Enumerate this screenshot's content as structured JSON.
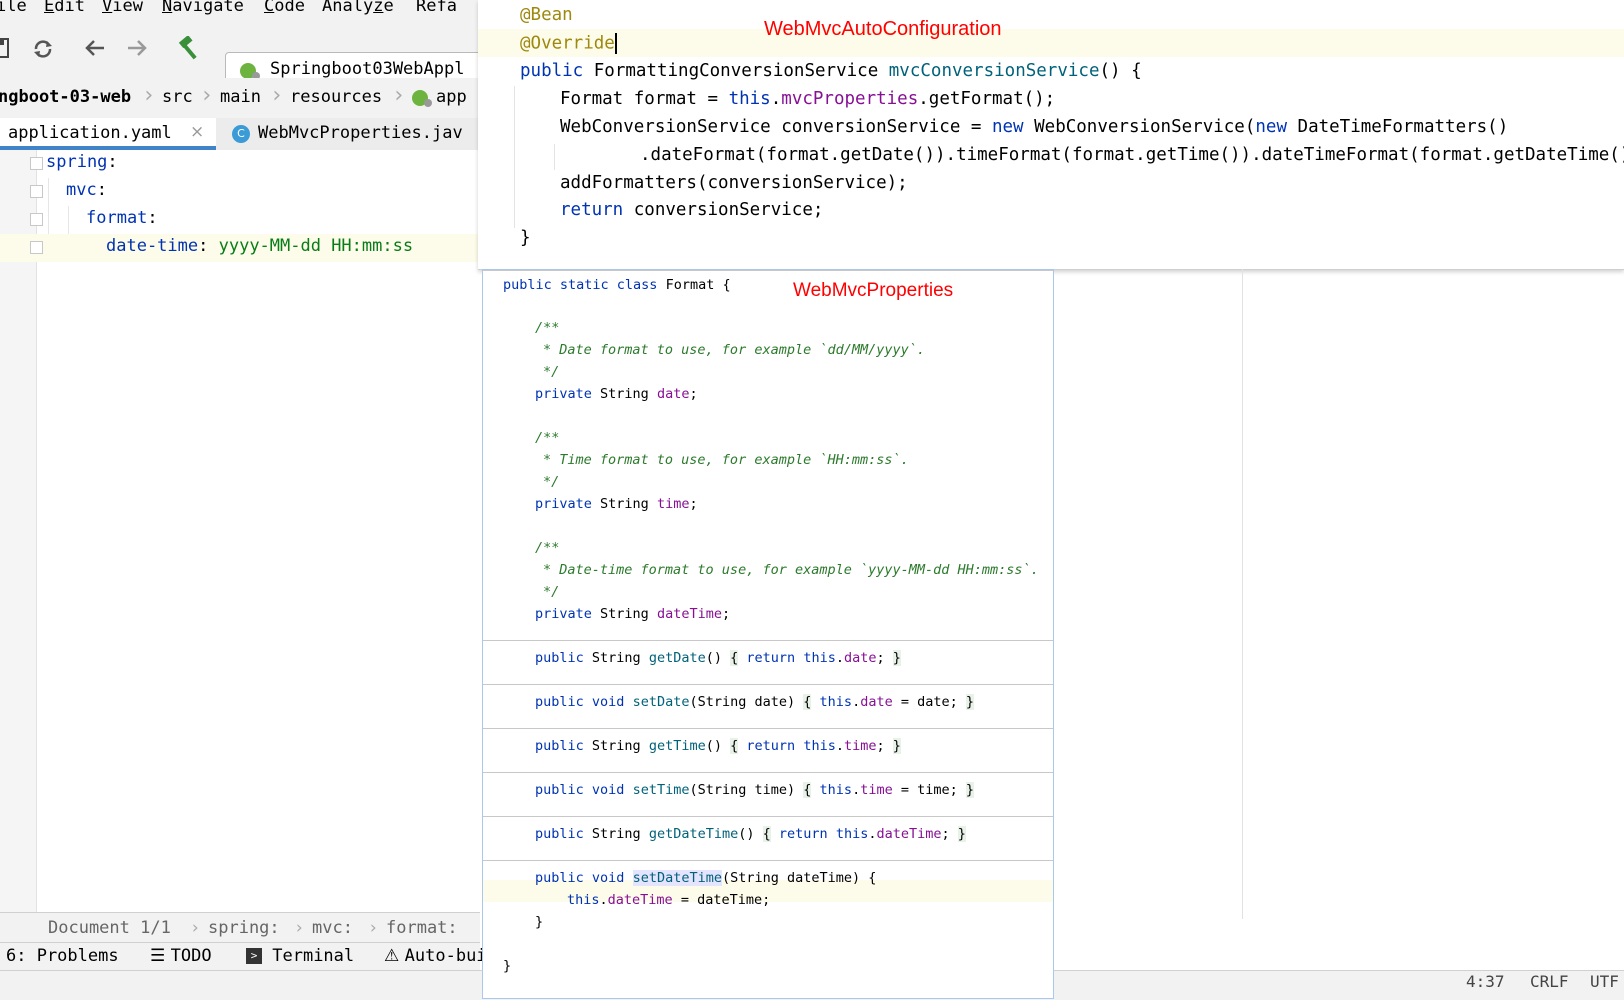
{
  "menu": [
    "ile",
    "Edit",
    "View",
    "Navigate",
    "Code",
    "Analyze",
    "Refa"
  ],
  "toolbar": {
    "run_config": "Springboot03WebAppl",
    "icons": [
      "save-icon",
      "sync-icon",
      "back-arrow-icon",
      "forward-arrow-icon",
      "build-hammer-icon",
      "spring-boot-icon"
    ]
  },
  "breadcrumb": [
    "ngboot-03-web",
    "src",
    "main",
    "resources",
    "app"
  ],
  "tabs": {
    "active": "application.yaml",
    "second": "WebMvcProperties.jav",
    "second_icon_letter": "C"
  },
  "yaml": {
    "lines": [
      {
        "key": "spring",
        "colon": ":",
        "value": ""
      },
      {
        "key": "mvc",
        "colon": ":",
        "value": ""
      },
      {
        "key": "format",
        "colon": ":",
        "value": ""
      },
      {
        "key": "date-time",
        "colon": ": ",
        "value": "yyyy-MM-dd HH:mm:ss"
      }
    ]
  },
  "status_breadcrumb": [
    "Document 1/1",
    "spring:",
    "mvc:",
    "format:"
  ],
  "toolwindows": [
    "6: Problems",
    "TODO",
    "Terminal",
    "Auto-bui"
  ],
  "statusbar": {
    "position": "4:37",
    "line_sep": "CRLF",
    "encoding": "UTF"
  },
  "auto_config": {
    "label": "WebMvcAutoConfiguration",
    "lines": {
      "l1": "@Bean",
      "l2": "@Override",
      "l3_kw": "public",
      "l3_type": " FormattingConversionService ",
      "l3_m": "mvcConversionService",
      "l3_end": "() {",
      "l4_a": "Format format = ",
      "l4_this": "this",
      "l4_dot": ".",
      "l4_f": "mvcProperties",
      "l4_end": ".getFormat();",
      "l5_a": "WebConversionService conversionService = ",
      "l5_new": "new",
      "l5_b": " WebConversionService(",
      "l5_new2": "new",
      "l5_c": " DateTimeFormatters()",
      "l6": ".dateFormat(format.getDate()).timeFormat(format.getTime()).dateTimeFormat(format.getDateTime()));",
      "l7": "addFormatters(conversionService);",
      "l8_kw": "return",
      "l8_b": " conversionService;",
      "l9": "}"
    }
  },
  "props": {
    "label": "WebMvcProperties",
    "class_kw": "public static class",
    "class_name": " Format {",
    "doc_open": "/**",
    "doc_close": "*/",
    "date_doc": "* Date format to use, for example `dd/MM/yyyy`.",
    "time_doc": "* Time format to use, for example `HH:mm:ss`.",
    "datetime_doc": "* Date-time format to use, for example `yyyy-MM-dd HH:mm:ss`.",
    "private_kw": "private",
    "string_type": " String ",
    "f_date": "date",
    "f_time": "time",
    "f_datetime": "dateTime",
    "semi": ";",
    "public_kw": "public",
    "void_kw": " void ",
    "m_getDate": "getDate",
    "m_setDate": "setDate",
    "m_getTime": "getTime",
    "m_setTime": "setTime",
    "m_getDateTime": "getDateTime",
    "m_setDateTime": "setDateTime",
    "empty_params": "() ",
    "brace_open": "{",
    "brace_close": "}",
    "return_kw": "return",
    "this_kw": "this",
    "dot": ".",
    "p_date": "(String date) ",
    "p_time": "(String time) ",
    "p_datetime": "(String dateTime) {",
    "assign_date": " = date;",
    "assign_time": " = time;",
    "assign_datetime": " = dateTime;",
    "close_brace": "}"
  }
}
